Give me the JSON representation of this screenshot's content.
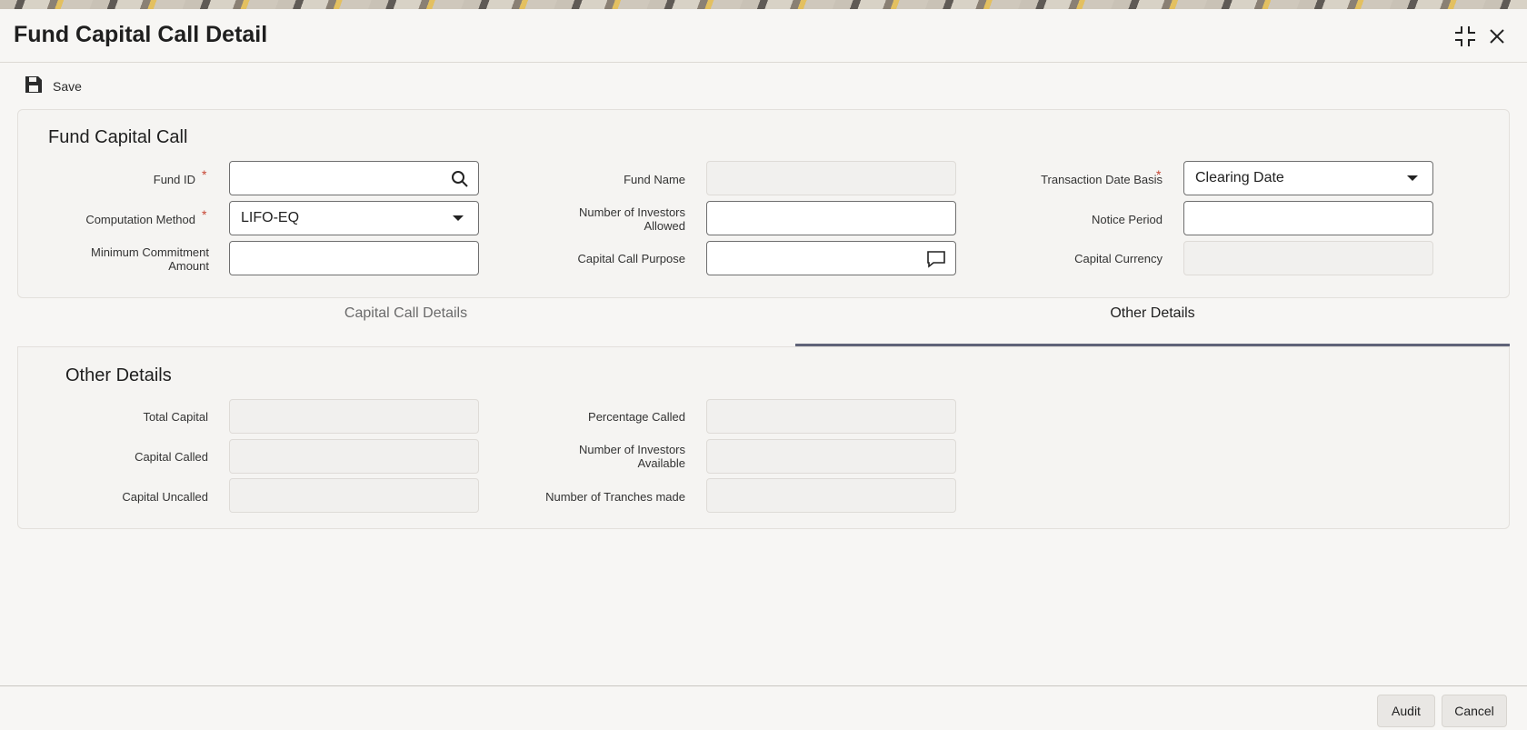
{
  "window": {
    "title": "Fund Capital Call Detail",
    "maximize_icon": "maximize-icon",
    "close_icon": "close-icon"
  },
  "toolbar": {
    "save_label": "Save",
    "save_icon": "floppy-disk-icon"
  },
  "fund_capital_call": {
    "title": "Fund Capital Call",
    "fund_id": {
      "label": "Fund ID",
      "required": "*",
      "value": ""
    },
    "fund_name": {
      "label": "Fund Name",
      "value": ""
    },
    "transaction_date_basis": {
      "label": "Transaction Date Basis",
      "required": "*",
      "value": "Clearing Date"
    },
    "computation_method": {
      "label": "Computation Method",
      "required": "*",
      "value": "LIFO-EQ"
    },
    "number_of_investors_allowed": {
      "label_line1": "Number of Investors",
      "label_line2": "Allowed",
      "value": ""
    },
    "notice_period": {
      "label": "Notice Period",
      "value": ""
    },
    "minimum_commitment_amount": {
      "label_line1": "Minimum Commitment",
      "label_line2": "Amount",
      "value": ""
    },
    "capital_call_purpose": {
      "label": "Capital Call Purpose",
      "value": ""
    },
    "capital_currency": {
      "label": "Capital Currency",
      "value": ""
    }
  },
  "tabs": [
    {
      "label": "Capital Call Details",
      "active": false
    },
    {
      "label": "Other Details",
      "active": true
    }
  ],
  "other_details": {
    "title": "Other Details",
    "total_capital": {
      "label": "Total Capital",
      "value": ""
    },
    "capital_called": {
      "label": "Capital Called",
      "value": ""
    },
    "capital_uncalled": {
      "label": "Capital Uncalled",
      "value": ""
    },
    "percentage_called": {
      "label": "Percentage Called",
      "value": ""
    },
    "number_of_investors_available": {
      "label_line1": "Number of Investors",
      "label_line2": "Available",
      "value": ""
    },
    "number_of_tranches_made": {
      "label": "Number of Tranches made",
      "value": ""
    }
  },
  "footer": {
    "audit_label": "Audit",
    "cancel_label": "Cancel"
  },
  "colors": {
    "required": "#c74634",
    "active_tab_underline": "#5f6378",
    "background": "#f7f6f4"
  }
}
